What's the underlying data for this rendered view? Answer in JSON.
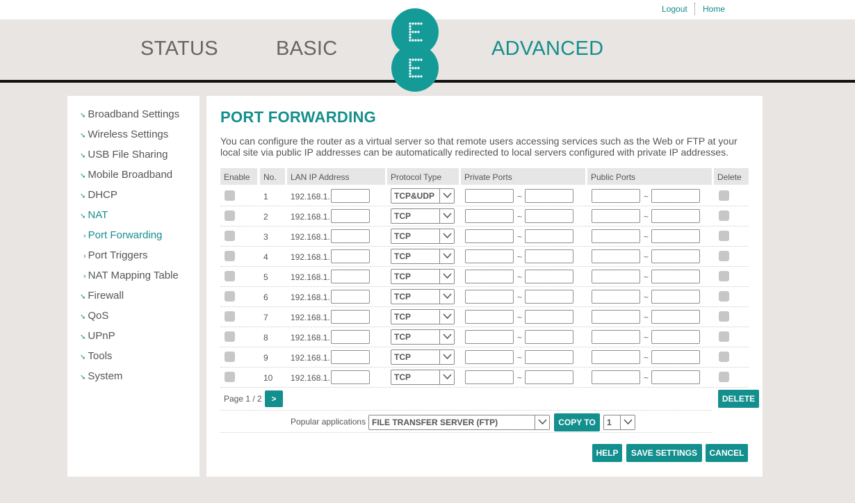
{
  "top_links": {
    "logout": "Logout",
    "home": "Home"
  },
  "nav": {
    "status": "STATUS",
    "basic": "BASIC",
    "advanced": "ADVANCED"
  },
  "logo": {
    "letter": "E"
  },
  "colors": {
    "accent": "#158e8d",
    "text": "#555555",
    "background": "#e8e5e2"
  },
  "sidebar": {
    "items": [
      {
        "label": "Broadband Settings"
      },
      {
        "label": "Wireless Settings"
      },
      {
        "label": "USB File Sharing"
      },
      {
        "label": "Mobile Broadband"
      },
      {
        "label": "DHCP"
      },
      {
        "label": "NAT"
      },
      {
        "label": "Port Forwarding"
      },
      {
        "label": "Port Triggers"
      },
      {
        "label": "NAT Mapping Table"
      },
      {
        "label": "Firewall"
      },
      {
        "label": "QoS"
      },
      {
        "label": "UPnP"
      },
      {
        "label": "Tools"
      },
      {
        "label": "System"
      }
    ]
  },
  "page": {
    "title": "PORT FORWARDING",
    "description": "You can configure the router as a virtual server so that remote users accessing services such as the Web or FTP at your local site via public IP addresses can be automatically redirected to local servers configured with private IP addresses."
  },
  "table": {
    "headers": {
      "enable": "Enable",
      "no": "No.",
      "lan_ip": "LAN IP Address",
      "protocol": "Protocol Type",
      "private_ports": "Private Ports",
      "public_ports": "Public Ports",
      "delete": "Delete"
    },
    "ip_prefix": "192.168.1.",
    "tilde": "~",
    "rows": [
      {
        "no": "1",
        "protocol": "TCP&UDP"
      },
      {
        "no": "2",
        "protocol": "TCP"
      },
      {
        "no": "3",
        "protocol": "TCP"
      },
      {
        "no": "4",
        "protocol": "TCP"
      },
      {
        "no": "5",
        "protocol": "TCP"
      },
      {
        "no": "6",
        "protocol": "TCP"
      },
      {
        "no": "7",
        "protocol": "TCP"
      },
      {
        "no": "8",
        "protocol": "TCP"
      },
      {
        "no": "9",
        "protocol": "TCP"
      },
      {
        "no": "10",
        "protocol": "TCP"
      }
    ]
  },
  "pagination": {
    "label": "Page 1 / 2",
    "next": ">"
  },
  "buttons": {
    "delete": "DELETE",
    "copy_to": "COPY TO",
    "help": "HELP",
    "save": "SAVE SETTINGS",
    "cancel": "CANCEL"
  },
  "popular": {
    "label": "Popular applications",
    "selected": "FILE TRANSFER SERVER (FTP)",
    "copy_target": "1"
  }
}
